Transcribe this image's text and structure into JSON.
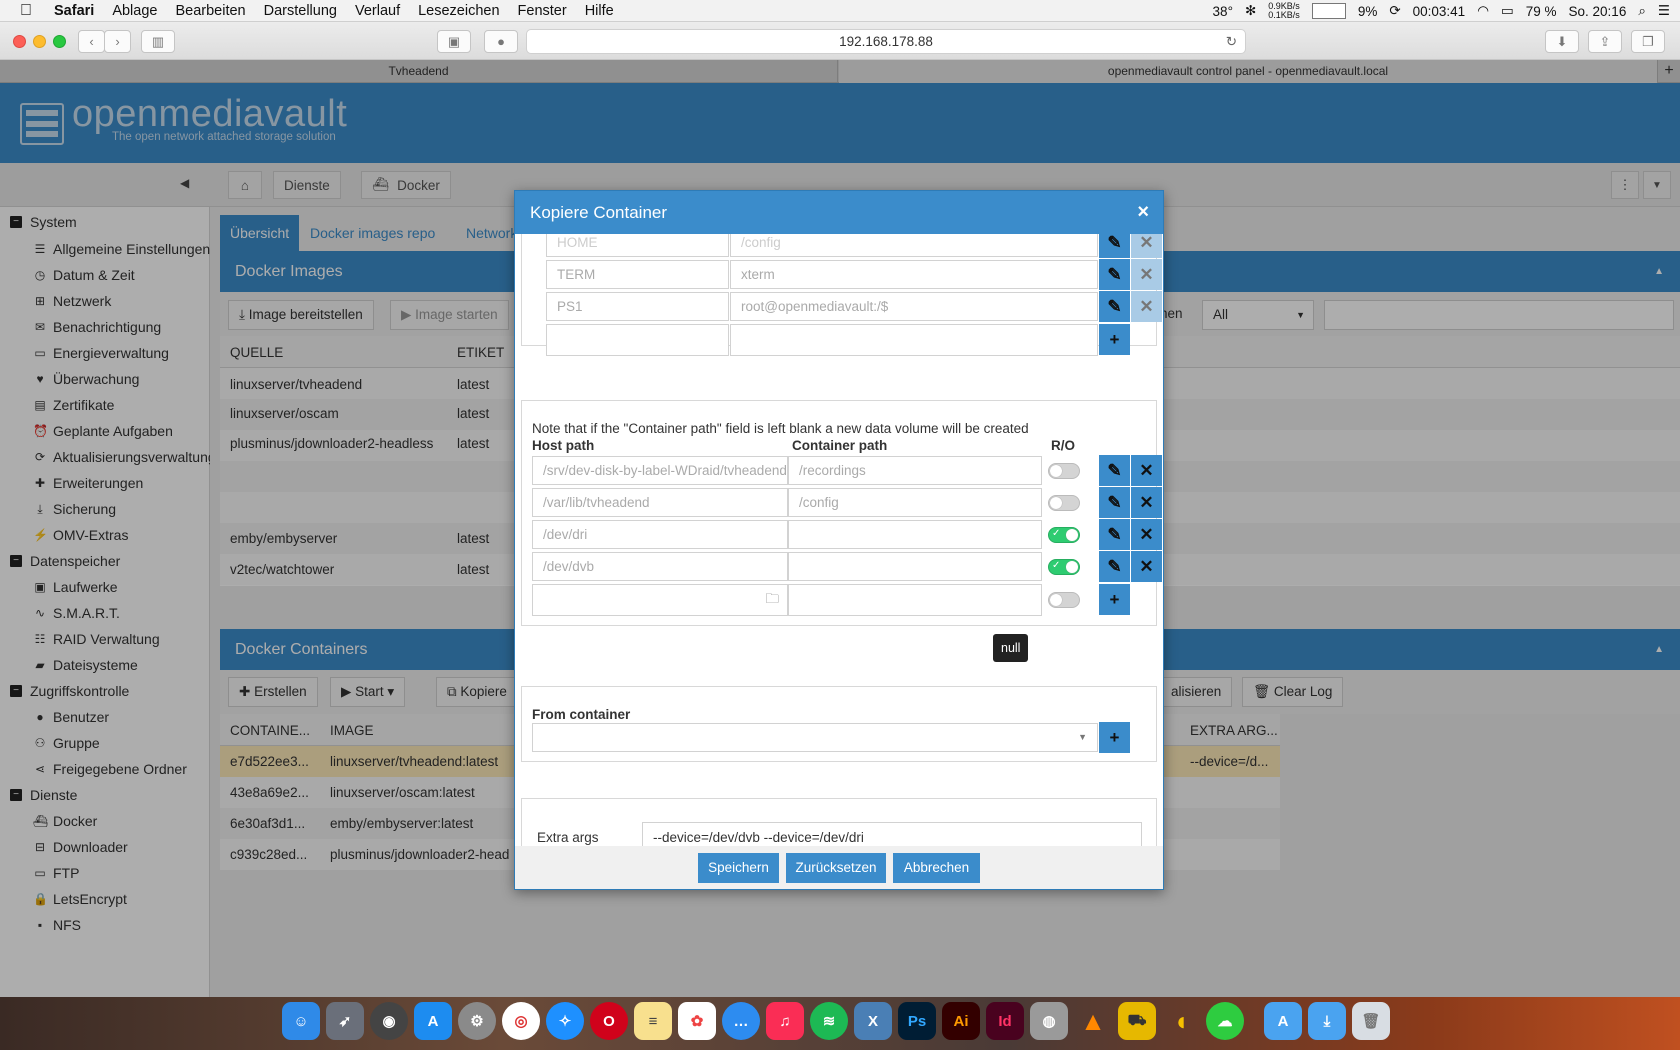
{
  "menubar": {
    "app": "Safari",
    "items": [
      "Ablage",
      "Bearbeiten",
      "Darstellung",
      "Verlauf",
      "Lesezeichen",
      "Fenster",
      "Hilfe"
    ],
    "temp": "38°",
    "net_up": "0.9KB/s",
    "net_down": "0.1KB/s",
    "cpu": "9%",
    "battery_time": "00:03:41",
    "battery": "79 %",
    "clock": "So. 20:16"
  },
  "browser": {
    "url": "192.168.178.88",
    "tabs": [
      "Tvheadend",
      "openmediavault control panel - openmediavault.local"
    ]
  },
  "omv": {
    "logo": "openmediavault",
    "tagline": "The open network attached storage solution",
    "breadcrumb": [
      "Dienste",
      "Docker"
    ],
    "tabs": [
      "Übersicht",
      "Docker images repo",
      "Network"
    ],
    "images_panel": "Docker Images",
    "images_toolbar": {
      "deploy": "Image bereitstellen",
      "start": "Image starten",
      "filter_label": "hen",
      "filter_value": "All"
    },
    "images_cols": [
      "QUELLE",
      "ETIKET"
    ],
    "images_rows": [
      [
        "linuxserver/tvheadend",
        "latest"
      ],
      [
        "linuxserver/oscam",
        "latest"
      ],
      [
        "plusminus/jdownloader2-headless",
        "latest"
      ],
      [
        "",
        ""
      ],
      [
        "",
        ""
      ],
      [
        "emby/embyserver",
        "latest"
      ],
      [
        "v2tec/watchtower",
        "latest"
      ]
    ],
    "containers_panel": "Docker Containers",
    "containers_toolbar": {
      "create": "Erstellen",
      "start": "Start",
      "copy": "Kopiere",
      "refresh": "alisieren",
      "clearlog": "Clear Log"
    },
    "containers_cols": [
      "CONTAINE...",
      "IMAGE",
      "EXTRA ARG..."
    ],
    "containers_rows": [
      [
        "e7d522ee3...",
        "linuxserver/tvheadend:latest",
        "--device=/d..."
      ],
      [
        "43e8a69e2...",
        "linuxserver/oscam:latest",
        ""
      ],
      [
        "6e30af3d1...",
        "emby/embyserver:latest",
        ""
      ],
      [
        "c939c28ed...",
        "plusminus/jdownloader2-head",
        ""
      ]
    ]
  },
  "sidebar": {
    "groups": [
      {
        "label": "System",
        "items": [
          "Allgemeine Einstellungen",
          "Datum & Zeit",
          "Netzwerk",
          "Benachrichtigung",
          "Energieverwaltung",
          "Überwachung",
          "Zertifikate",
          "Geplante Aufgaben",
          "Aktualisierungsverwaltung",
          "Erweiterungen",
          "Sicherung",
          "OMV-Extras"
        ]
      },
      {
        "label": "Datenspeicher",
        "items": [
          "Laufwerke",
          "S.M.A.R.T.",
          "RAID Verwaltung",
          "Dateisysteme"
        ]
      },
      {
        "label": "Zugriffskontrolle",
        "items": [
          "Benutzer",
          "Gruppe",
          "Freigegebene Ordner"
        ]
      },
      {
        "label": "Dienste",
        "items": [
          "Docker",
          "Downloader",
          "FTP",
          "LetsEncrypt",
          "NFS"
        ]
      }
    ]
  },
  "modal": {
    "title": "Kopiere Container",
    "env_rows": [
      {
        "name": "HOME",
        "value": "/config"
      },
      {
        "name": "TERM",
        "value": "xterm"
      },
      {
        "name": "PS1",
        "value": "root@openmediavault:/$"
      }
    ],
    "volume_note": "Note that if the \"Container path\" field is left blank a new data volume will be created",
    "volume_cols": {
      "host": "Host path",
      "container": "Container path",
      "ro": "R/O"
    },
    "volumes": [
      {
        "host": "/srv/dev-disk-by-label-WDraid/tvheadend",
        "container": "/recordings",
        "ro": false
      },
      {
        "host": "/var/lib/tvheadend",
        "container": "/config",
        "ro": false
      },
      {
        "host": "/dev/dri",
        "container": "",
        "ro": true
      },
      {
        "host": "/dev/dvb",
        "container": "",
        "ro": true
      }
    ],
    "tooltip": "null",
    "from_container_label": "From container",
    "extra_args_label": "Extra args",
    "extra_args_value": "--device=/dev/dvb --device=/dev/dri",
    "buttons": {
      "save": "Speichern",
      "reset": "Zurücksetzen",
      "cancel": "Abbrechen"
    }
  },
  "colors": {
    "accent": "#3b8ccb",
    "toggle_on": "#2ecc71"
  }
}
